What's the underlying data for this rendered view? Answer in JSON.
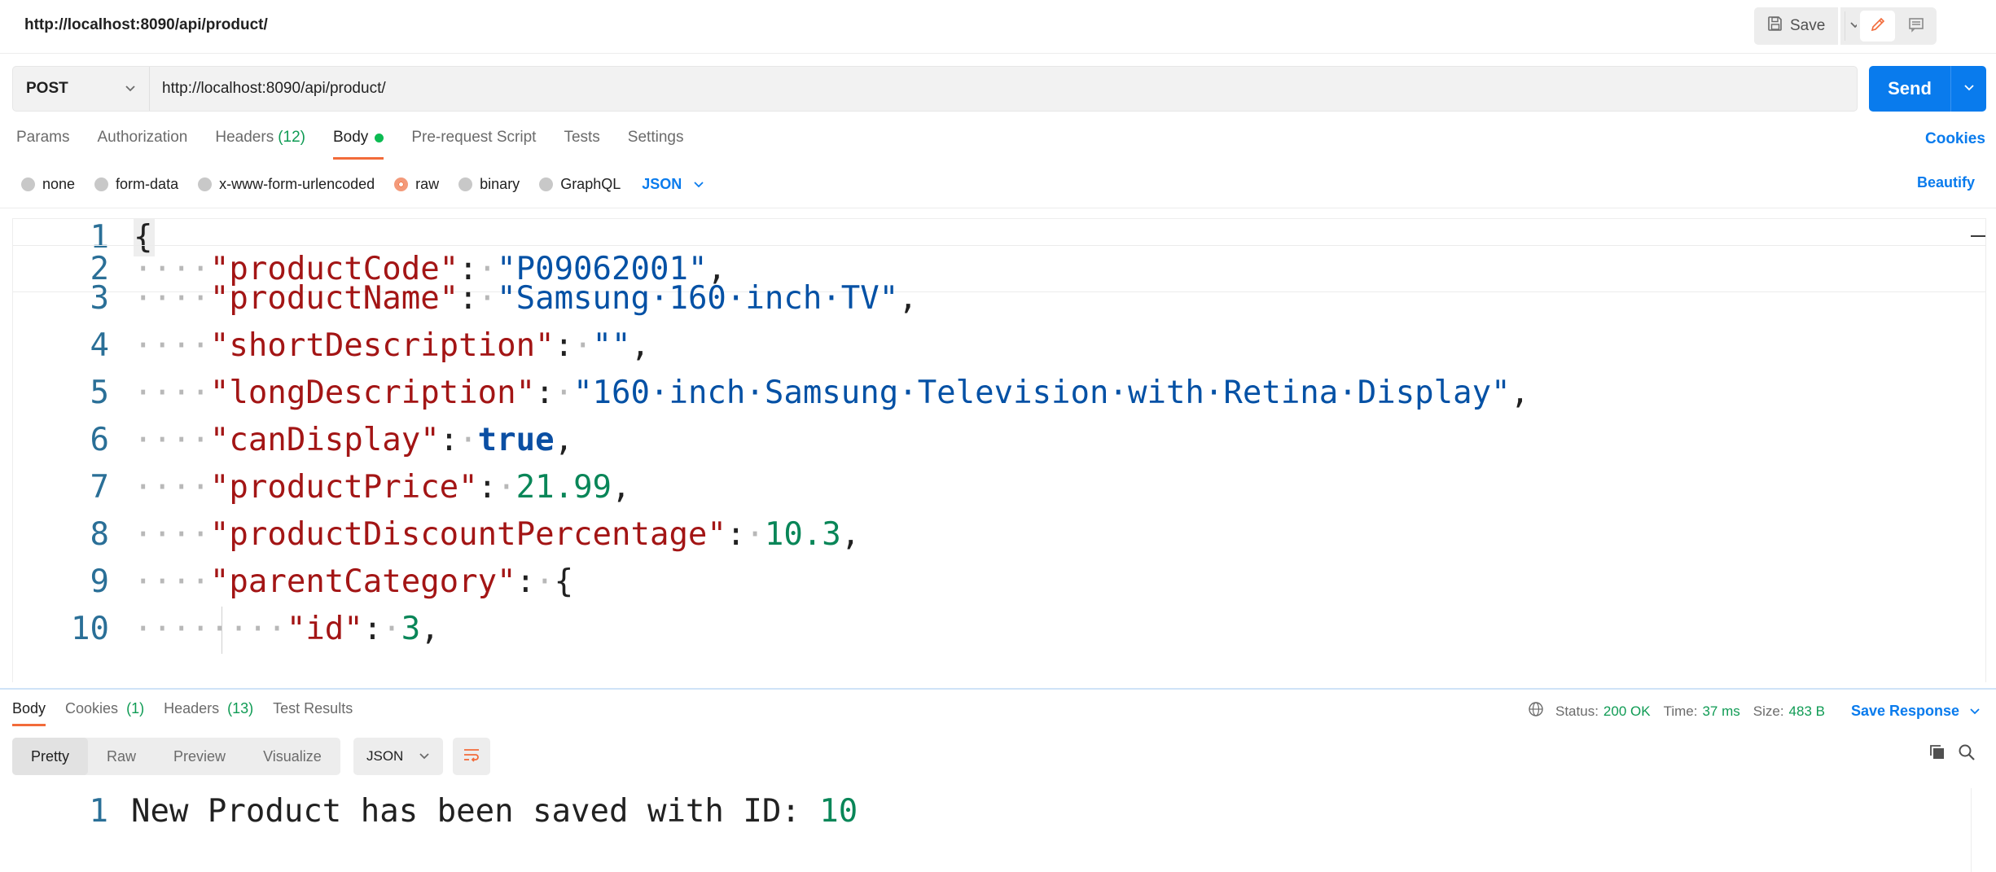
{
  "top": {
    "tab_url": "http://localhost:8090/api/product/",
    "save_label": "Save"
  },
  "request": {
    "method": "POST",
    "url": "http://localhost:8090/api/product/",
    "send_label": "Send"
  },
  "req_tabs": {
    "params": "Params",
    "authorization": "Authorization",
    "headers": "Headers",
    "headers_count": "(12)",
    "body": "Body",
    "pre_request": "Pre-request Script",
    "tests": "Tests",
    "settings": "Settings",
    "cookies": "Cookies"
  },
  "body_types": {
    "none": "none",
    "form_data": "form-data",
    "urlencoded": "x-www-form-urlencoded",
    "raw": "raw",
    "binary": "binary",
    "graphql": "GraphQL",
    "language": "JSON",
    "beautify": "Beautify"
  },
  "editor": {
    "line_numbers": [
      "1",
      "2",
      "3",
      "4",
      "5",
      "6",
      "7",
      "8",
      "9",
      "10"
    ],
    "brace_open": "{",
    "fields": {
      "productCode": {
        "key": "\"productCode\"",
        "value": "\"P09062001\""
      },
      "productName": {
        "key": "\"productName\"",
        "value": "\"Samsung·160·inch·TV\""
      },
      "shortDescription": {
        "key": "\"shortDescription\"",
        "value": "\"\""
      },
      "longDescription": {
        "key": "\"longDescription\"",
        "value": "\"160·inch·Samsung·Television·with·Retina·Display\""
      },
      "canDisplay": {
        "key": "\"canDisplay\"",
        "value": "true"
      },
      "productPrice": {
        "key": "\"productPrice\"",
        "value": "21.99"
      },
      "productDiscountPercentage": {
        "key": "\"productDiscountPercentage\"",
        "value": "10.3"
      },
      "parentCategory": {
        "key": "\"parentCategory\"",
        "value": "{"
      },
      "id": {
        "key": "\"id\"",
        "value": "3"
      }
    }
  },
  "response": {
    "tabs": {
      "body": "Body",
      "cookies": "Cookies",
      "cookies_count": "(1)",
      "headers": "Headers",
      "headers_count": "(13)",
      "test_results": "Test Results"
    },
    "status_label": "Status:",
    "status_value": "200 OK",
    "time_label": "Time:",
    "time_value": "37 ms",
    "size_label": "Size:",
    "size_value": "483 B",
    "save_response": "Save Response",
    "formats": {
      "pretty": "Pretty",
      "raw": "Raw",
      "preview": "Preview",
      "visualize": "Visualize"
    },
    "language": "JSON",
    "line_number": "1",
    "message_text": "New Product has been saved with ID: ",
    "message_id": "10"
  },
  "colors": {
    "accent": "#097bed",
    "active_tab": "#f26b3a",
    "success": "#0f9b54"
  },
  "icons": [
    "save-icon",
    "chevron-down-icon",
    "pencil-icon",
    "comment-icon",
    "globe-icon",
    "wrap-lines-icon",
    "copy-icon",
    "search-icon"
  ]
}
